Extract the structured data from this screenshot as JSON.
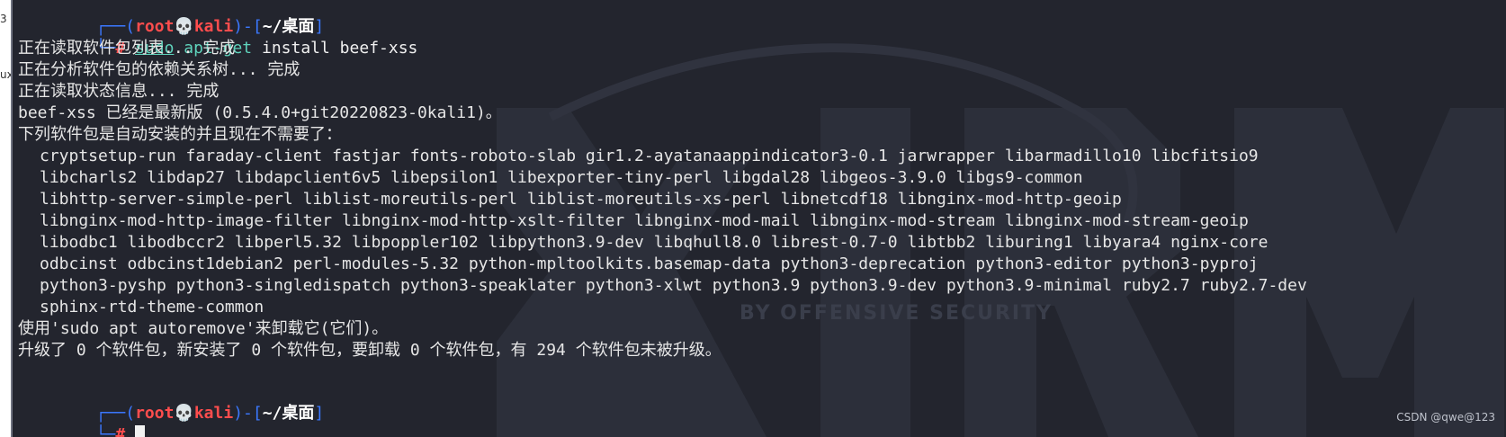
{
  "left_strip": {
    "fragment_top": "3",
    "fragment_mid": "ux"
  },
  "prompt": {
    "box_open": "┌──(",
    "user": "root",
    "skull": "💀",
    "host": "kali",
    "box_mid": ")-[",
    "dir": "~/桌面",
    "box_close": "]",
    "box_bottom": "└─",
    "hash": "#"
  },
  "command": {
    "sudo": "sudo",
    "bin": "apt-get",
    "args": "install beef-xss"
  },
  "output": {
    "line1": "正在读取软件包列表... 完成",
    "line2": "正在分析软件包的依赖关系树... 完成",
    "line3": "正在读取状态信息... 完成",
    "line4": "beef-xss 已经是最新版 (0.5.4.0+git20220823-0kali1)。",
    "line5": "下列软件包是自动安装的并且现在不需要了：",
    "packages": [
      "cryptsetup-run faraday-client fastjar fonts-roboto-slab gir1.2-ayatanaappindicator3-0.1 jarwrapper libarmadillo10 libcfitsio9",
      "libcharls2 libdap27 libdapclient6v5 libepsilon1 libexporter-tiny-perl libgdal28 libgeos-3.9.0 libgs9-common",
      "libhttp-server-simple-perl liblist-moreutils-perl liblist-moreutils-xs-perl libnetcdf18 libnginx-mod-http-geoip",
      "libnginx-mod-http-image-filter libnginx-mod-http-xslt-filter libnginx-mod-mail libnginx-mod-stream libnginx-mod-stream-geoip",
      "libodbc1 libodbccr2 libperl5.32 libpoppler102 libpython3.9-dev libqhull8.0 librest-0.7-0 libtbb2 liburing1 libyara4 nginx-core",
      "odbcinst odbcinst1debian2 perl-modules-5.32 python-mpltoolkits.basemap-data python3-deprecation python3-editor python3-pyproj",
      "python3-pyshp python3-singledispatch python3-speaklater python3-xlwt python3.9 python3.9-dev python3.9-minimal ruby2.7 ruby2.7-dev",
      "sphinx-rtd-theme-common"
    ],
    "autoremove": "使用'sudo apt autoremove'来卸载它(它们)。",
    "summary": "升级了 0 个软件包，新安装了 0 个软件包，要卸载 0 个软件包，有 294 个软件包未被升级。"
  },
  "watermark_text": "BY OFFENSIVE SECURITY",
  "credit": "CSDN @qwe@123",
  "colors": {
    "background": "#23252e",
    "prompt_box": "#3b78ff",
    "prompt_user": "#ff4d4d",
    "command": "#5fd3bc",
    "text": "#e6e6e6"
  }
}
